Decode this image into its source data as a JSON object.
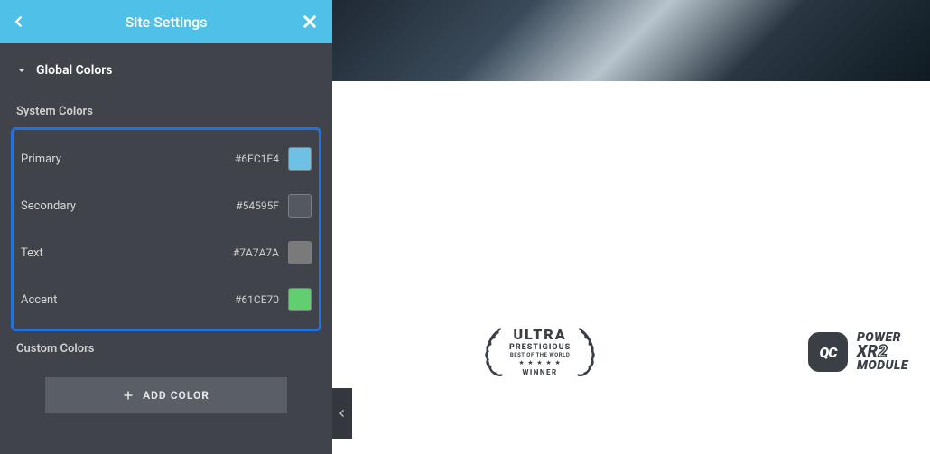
{
  "header": {
    "title": "Site Settings"
  },
  "section": {
    "title": "Global Colors"
  },
  "system": {
    "title": "System Colors",
    "rows": [
      {
        "name": "Primary",
        "hex": "#6EC1E4",
        "swatch": "#6EC1E4"
      },
      {
        "name": "Secondary",
        "hex": "#54595F",
        "swatch": "#54595F"
      },
      {
        "name": "Text",
        "hex": "#7A7A7A",
        "swatch": "#7A7A7A"
      },
      {
        "name": "Accent",
        "hex": "#61CE70",
        "swatch": "#61CE70"
      }
    ]
  },
  "custom": {
    "title": "Custom Colors",
    "add_label": "ADD COLOR"
  },
  "badge1": {
    "l1": "ULTRA",
    "l2": "PRESTIGIOUS",
    "l3": "BEST OF THE WORLD",
    "stars": "★ ★ ★ ★ ★",
    "l4": "WINNER"
  },
  "badge2": {
    "logo": "QC",
    "l1": "POWER",
    "l2a": "XR",
    "l2b": "2",
    "l3": "MODULE"
  }
}
